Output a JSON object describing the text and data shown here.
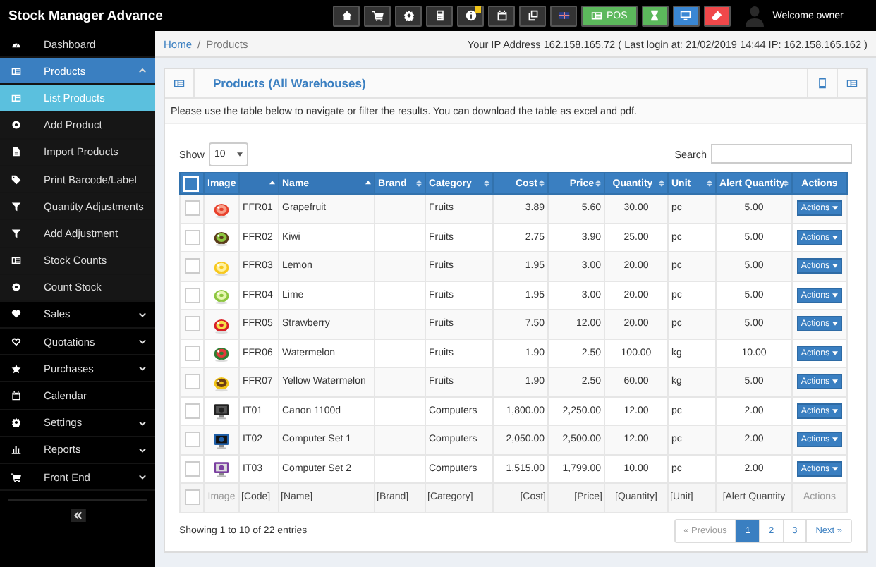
{
  "app_title": "Stock Manager Advance",
  "toolbar": [
    {
      "kind": "icon",
      "color": "#333333",
      "alert": false
    },
    {
      "kind": "icon",
      "color": "#333333",
      "alert": false
    },
    {
      "kind": "icon",
      "color": "#333333",
      "alert": false
    },
    {
      "kind": "icon",
      "color": "#333333",
      "alert": false
    },
    {
      "kind": "icon",
      "color": "#333333",
      "alert": true
    },
    {
      "kind": "icon",
      "color": "#333333",
      "alert": false
    },
    {
      "kind": "icon",
      "color": "#333333",
      "alert": false
    },
    {
      "kind": "icon",
      "color": "#333333",
      "alert": false
    },
    {
      "kind": "text",
      "label": "POS",
      "color": "#5cb85c",
      "alert": false
    },
    {
      "kind": "icon",
      "color": "#5cb85c",
      "alert": false
    },
    {
      "kind": "icon",
      "color": "#3a87d4",
      "alert": false
    },
    {
      "kind": "icon",
      "color": "#f0484a",
      "alert": false
    }
  ],
  "user": {
    "welcome": "Welcome owner"
  },
  "sidebar": {
    "items": [
      {
        "label": "Dashboard",
        "kind": "link",
        "selected": false
      },
      {
        "label": "Products",
        "kind": "group",
        "expanded": true,
        "selected": false,
        "children": [
          {
            "label": "List Products",
            "selected": true
          },
          {
            "label": "Add Product",
            "selected": false
          },
          {
            "label": "Import Products",
            "selected": false
          },
          {
            "label": "Print Barcode/Label",
            "selected": false
          },
          {
            "label": "Quantity Adjustments",
            "selected": false
          },
          {
            "label": "Add Adjustment",
            "selected": false
          },
          {
            "label": "Stock Counts",
            "selected": false
          },
          {
            "label": "Count Stock",
            "selected": false
          }
        ]
      },
      {
        "label": "Sales",
        "kind": "group",
        "expanded": false,
        "selected": false
      },
      {
        "label": "Quotations",
        "kind": "group",
        "expanded": false,
        "selected": false
      },
      {
        "label": "Purchases",
        "kind": "group",
        "expanded": false,
        "selected": false
      },
      {
        "label": "Calendar",
        "kind": "link",
        "selected": false
      },
      {
        "label": "Settings",
        "kind": "group",
        "expanded": false,
        "selected": false
      },
      {
        "label": "Reports",
        "kind": "group",
        "expanded": false,
        "selected": false
      },
      {
        "label": "Front End",
        "kind": "group",
        "expanded": false,
        "selected": false
      }
    ]
  },
  "breadcrumb": [
    "Home",
    "/",
    "Products"
  ],
  "login_info": "Your IP Address 162.158.165.72 ( Last login at: 21/02/2019 14:44 IP: 162.158.165.162 )",
  "panel": {
    "title": "Products (All Warehouses)",
    "intro": "Please use the table below to navigate or filter the results. You can download the table as excel and pdf."
  },
  "length_menu": {
    "label": "Show",
    "value": "10"
  },
  "search": {
    "label": "Search"
  },
  "table": {
    "select_all_checked": false,
    "columns": [
      {
        "label": "Image",
        "sortable": false,
        "sorted_ascending": false
      },
      {
        "sortable": true,
        "sorted_ascending": true
      },
      {
        "label": "Name",
        "sortable": true,
        "sorted_ascending": true
      },
      {
        "label": "Brand",
        "sortable": true,
        "sorted_ascending": false
      },
      {
        "label": "Category",
        "sortable": true,
        "sorted_ascending": false
      },
      {
        "label": "Cost",
        "sortable": true,
        "sorted_ascending": false
      },
      {
        "label": "Price",
        "sortable": true,
        "sorted_ascending": false
      },
      {
        "label": "Quantity",
        "sortable": true,
        "sorted_ascending": false
      },
      {
        "label": "Unit",
        "sortable": true,
        "sorted_ascending": false
      },
      {
        "label": "Alert Quantity",
        "sortable": true,
        "sorted_ascending": false
      },
      {
        "label": "Actions",
        "sortable": false,
        "sorted_ascending": false
      }
    ],
    "rows": [
      {
        "checked": false,
        "code": "FFR01",
        "name": "Grapefruit",
        "category": "Fruits",
        "cost": "3.89",
        "price": "5.60",
        "quantity": "30.00",
        "unit": "pc",
        "alert_quantity": "5.00",
        "action": "Actions"
      },
      {
        "checked": false,
        "code": "FFR02",
        "name": "Kiwi",
        "category": "Fruits",
        "cost": "2.75",
        "price": "3.90",
        "quantity": "25.00",
        "unit": "pc",
        "alert_quantity": "5.00",
        "action": "Actions"
      },
      {
        "checked": false,
        "code": "FFR03",
        "name": "Lemon",
        "category": "Fruits",
        "cost": "1.95",
        "price": "3.00",
        "quantity": "20.00",
        "unit": "pc",
        "alert_quantity": "5.00",
        "action": "Actions"
      },
      {
        "checked": false,
        "code": "FFR04",
        "name": "Lime",
        "category": "Fruits",
        "cost": "1.95",
        "price": "3.00",
        "quantity": "20.00",
        "unit": "pc",
        "alert_quantity": "5.00",
        "action": "Actions"
      },
      {
        "checked": false,
        "code": "FFR05",
        "name": "Strawberry",
        "category": "Fruits",
        "cost": "7.50",
        "price": "12.00",
        "quantity": "20.00",
        "unit": "pc",
        "alert_quantity": "5.00",
        "action": "Actions"
      },
      {
        "checked": false,
        "code": "FFR06",
        "name": "Watermelon",
        "category": "Fruits",
        "cost": "1.90",
        "price": "2.50",
        "quantity": "100.00",
        "unit": "kg",
        "alert_quantity": "10.00",
        "action": "Actions"
      },
      {
        "checked": false,
        "code": "FFR07",
        "name": "Yellow Watermelon",
        "category": "Fruits",
        "cost": "1.90",
        "price": "2.50",
        "quantity": "60.00",
        "unit": "kg",
        "alert_quantity": "5.00",
        "action": "Actions"
      },
      {
        "checked": false,
        "code": "IT01",
        "name": "Canon 1100d",
        "category": "Computers",
        "cost": "1,800.00",
        "price": "2,250.00",
        "quantity": "12.00",
        "unit": "pc",
        "alert_quantity": "2.00",
        "action": "Actions"
      },
      {
        "checked": false,
        "code": "IT02",
        "name": "Computer Set 1",
        "category": "Computers",
        "cost": "2,050.00",
        "price": "2,500.00",
        "quantity": "12.00",
        "unit": "pc",
        "alert_quantity": "2.00",
        "action": "Actions"
      },
      {
        "checked": false,
        "code": "IT03",
        "name": "Computer Set 2",
        "category": "Computers",
        "cost": "1,515.00",
        "price": "1,799.00",
        "quantity": "10.00",
        "unit": "pc",
        "alert_quantity": "2.00",
        "action": "Actions"
      }
    ],
    "filter_checked": false,
    "filters": [
      "Image",
      "[Code]",
      "[Name]",
      "[Brand]",
      "[Category]",
      "[Cost]",
      "[Price]",
      "[Quantity]",
      "[Unit]",
      "[Alert Quantity",
      "Actions"
    ]
  },
  "summary": "Showing 1 to 10 of 22 entries",
  "pagination": [
    {
      "label": "« Previous",
      "disabled": true,
      "selected": false
    },
    {
      "label": "1",
      "disabled": false,
      "selected": true
    },
    {
      "label": "2",
      "disabled": false,
      "selected": false
    },
    {
      "label": "3",
      "disabled": false,
      "selected": false
    },
    {
      "label": "Next »",
      "disabled": false,
      "selected": false
    }
  ]
}
